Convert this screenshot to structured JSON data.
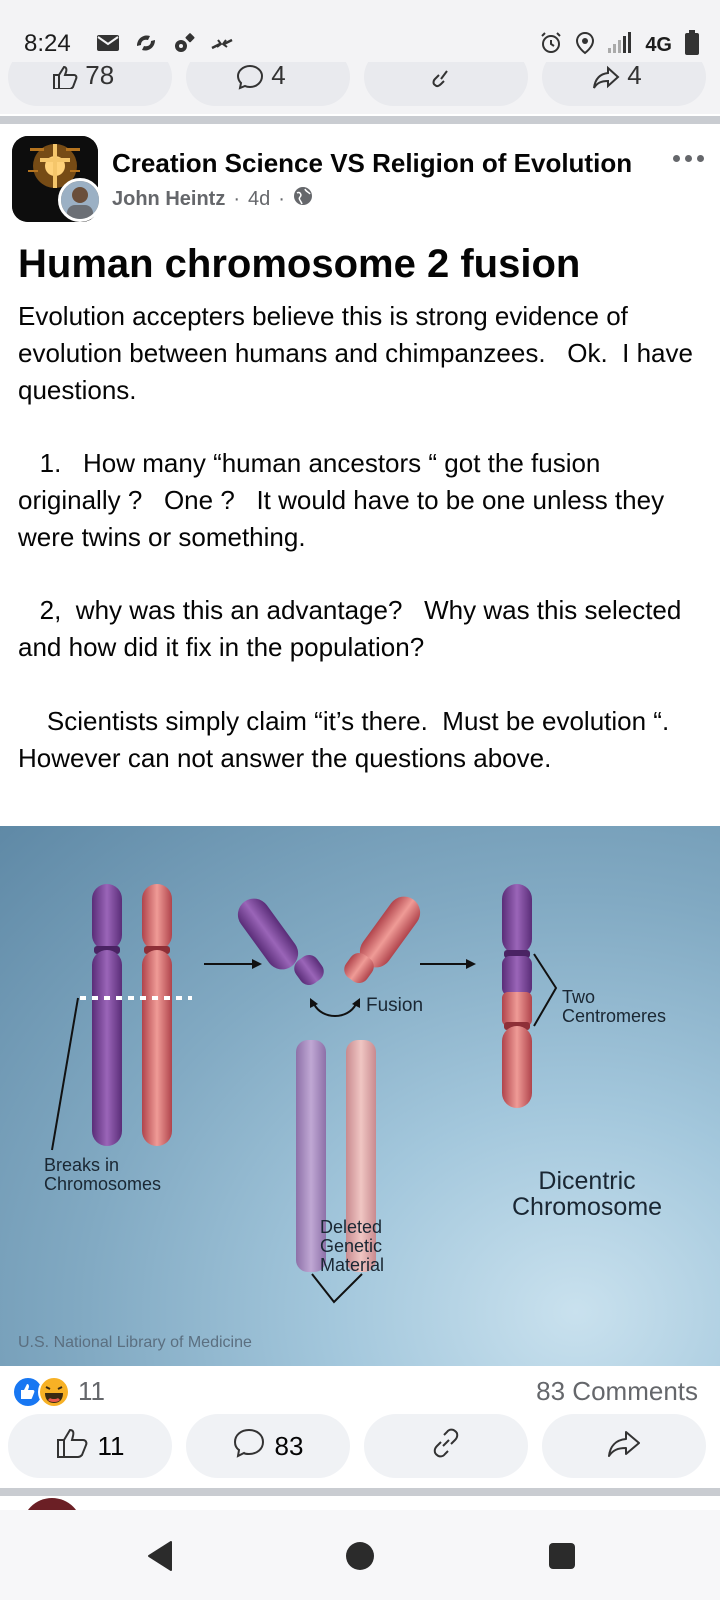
{
  "status_bar": {
    "time": "8:24",
    "network": "4G",
    "left_icons": [
      "mail-icon",
      "messenger-icon",
      "settings-icon",
      "collapse-icon"
    ],
    "right_icons": [
      "alarm-icon",
      "location-icon",
      "signal-icon",
      "battery-icon"
    ]
  },
  "previous_post": {
    "like_count": "78",
    "comment_count": "4",
    "share_count": "4"
  },
  "post": {
    "group_name": "Creation Science VS Religion of Evolution",
    "author": "John Heintz",
    "time_ago": "4d",
    "separator": "·",
    "privacy_icon": "globe-icon",
    "title": "Human chromosome 2 fusion",
    "body": "Evolution accepters believe this is strong evidence of evolution between humans and chimpanzees.   Ok.  I have questions.\n\n   1.   How many “human ancestors “ got the fusion originally ?   One ?   It would have to be one unless they were twins or something.\n\n   2,  why was this an advantage?   Why was this selected and how did it fix in the population?\n\n    Scientists simply claim “it’s there.  Must be evolution “.   However can not answer the questions above.",
    "image": {
      "labels": {
        "fusion": "Fusion",
        "two_centromeres": "Two\nCentromeres",
        "breaks": "Breaks in\nChromosomes",
        "deleted": "Deleted\nGenetic\nMaterial",
        "dicentric": "Dicentric\nChromosome",
        "credit": "U.S. National Library of Medicine"
      }
    },
    "reactions": {
      "types": [
        "like",
        "haha"
      ],
      "count": "11"
    },
    "comments_summary": "83 Comments",
    "actions": {
      "like_count": "11",
      "comment_count": "83"
    }
  },
  "colors": {
    "like_blue": "#1877f2",
    "haha_yellow": "#f7b125",
    "secondary_text": "#65676b",
    "pill_bg": "#f0f2f5"
  }
}
